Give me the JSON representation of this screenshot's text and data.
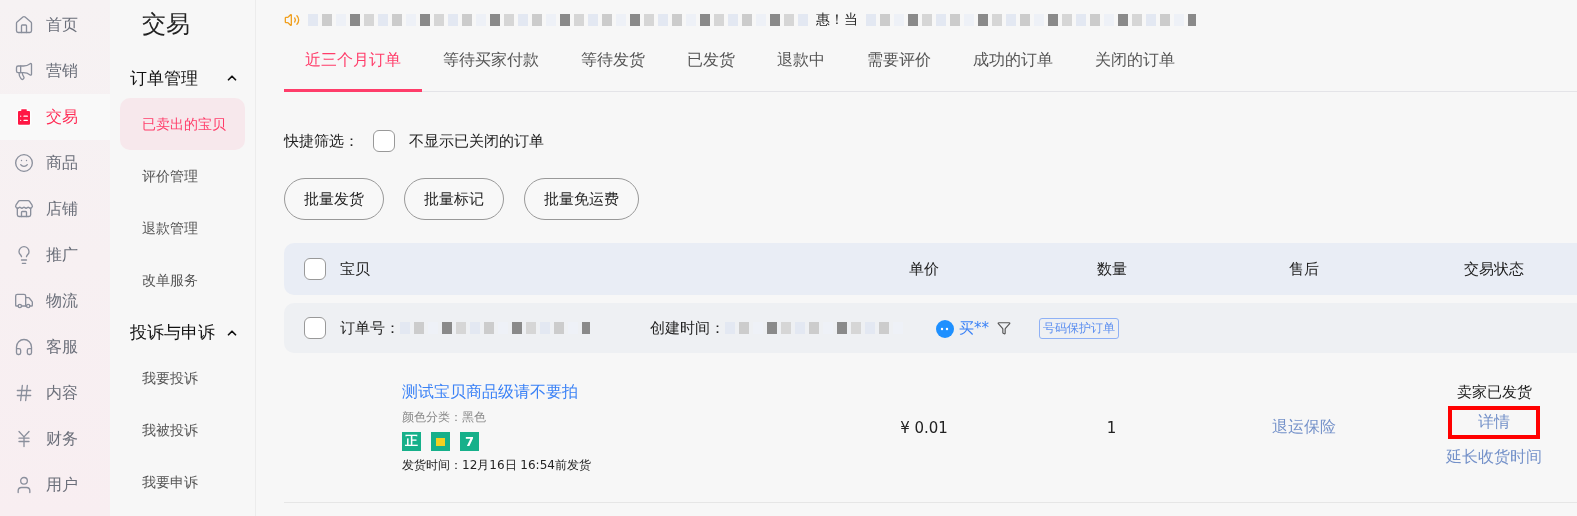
{
  "nav": {
    "items": [
      {
        "label": "首页",
        "selected": false
      },
      {
        "label": "营销",
        "selected": false
      },
      {
        "label": "交易",
        "selected": true
      },
      {
        "label": "商品",
        "selected": false
      },
      {
        "label": "店铺",
        "selected": false
      },
      {
        "label": "推广",
        "selected": false
      },
      {
        "label": "物流",
        "selected": false
      },
      {
        "label": "客服",
        "selected": false
      },
      {
        "label": "内容",
        "selected": false
      },
      {
        "label": "财务",
        "selected": false
      },
      {
        "label": "用户",
        "selected": false
      }
    ]
  },
  "sidebar": {
    "title": "交易",
    "groups": [
      {
        "label": "订单管理",
        "expanded": true,
        "items": [
          {
            "label": "已卖出的宝贝",
            "selected": true
          },
          {
            "label": "评价管理",
            "selected": false
          },
          {
            "label": "退款管理",
            "selected": false
          },
          {
            "label": "改单服务",
            "selected": false
          }
        ]
      },
      {
        "label": "投诉与申诉",
        "expanded": true,
        "items": [
          {
            "label": "我要投诉",
            "selected": false
          },
          {
            "label": "我被投诉",
            "selected": false
          },
          {
            "label": "我要申诉",
            "selected": false
          }
        ]
      }
    ]
  },
  "notice": {
    "text": "惠！当"
  },
  "tabs": [
    {
      "label": "近三个月订单",
      "selected": true
    },
    {
      "label": "等待买家付款",
      "selected": false
    },
    {
      "label": "等待发货",
      "selected": false
    },
    {
      "label": "已发货",
      "selected": false
    },
    {
      "label": "退款中",
      "selected": false
    },
    {
      "label": "需要评价",
      "selected": false
    },
    {
      "label": "成功的订单",
      "selected": false
    },
    {
      "label": "关闭的订单",
      "selected": false
    }
  ],
  "quick_filter": {
    "label": "快捷筛选：",
    "option": {
      "label": "不显示已关闭的订单",
      "checked": false
    }
  },
  "batch_buttons": [
    "批量发货",
    "批量标记",
    "批量免运费"
  ],
  "table": {
    "select_all": {
      "checked": false
    },
    "columns": [
      "宝贝",
      "单价",
      "数量",
      "售后",
      "交易状态"
    ],
    "orders": [
      {
        "checked": false,
        "order_no_label": "订单号：",
        "created_label": "创建时间：",
        "buyer": "买**",
        "tag": "号码保护订单",
        "item": {
          "title": "测试宝贝商品级请不要拍",
          "sku": "颜色分类：黑色",
          "badges": [
            {
              "kind": "text",
              "label": "正"
            },
            {
              "kind": "bag"
            },
            {
              "kind": "text",
              "label": "7"
            }
          ],
          "ship_time": "发货时间：12月16日 16:54前发货"
        },
        "price": "¥ 0.01",
        "quantity": "1",
        "after_sale": "退运保险",
        "status": "卖家已发货",
        "actions": [
          {
            "label": "详情",
            "highlighted": true
          },
          {
            "label": "延长收货时间",
            "highlighted": false
          }
        ]
      }
    ]
  }
}
